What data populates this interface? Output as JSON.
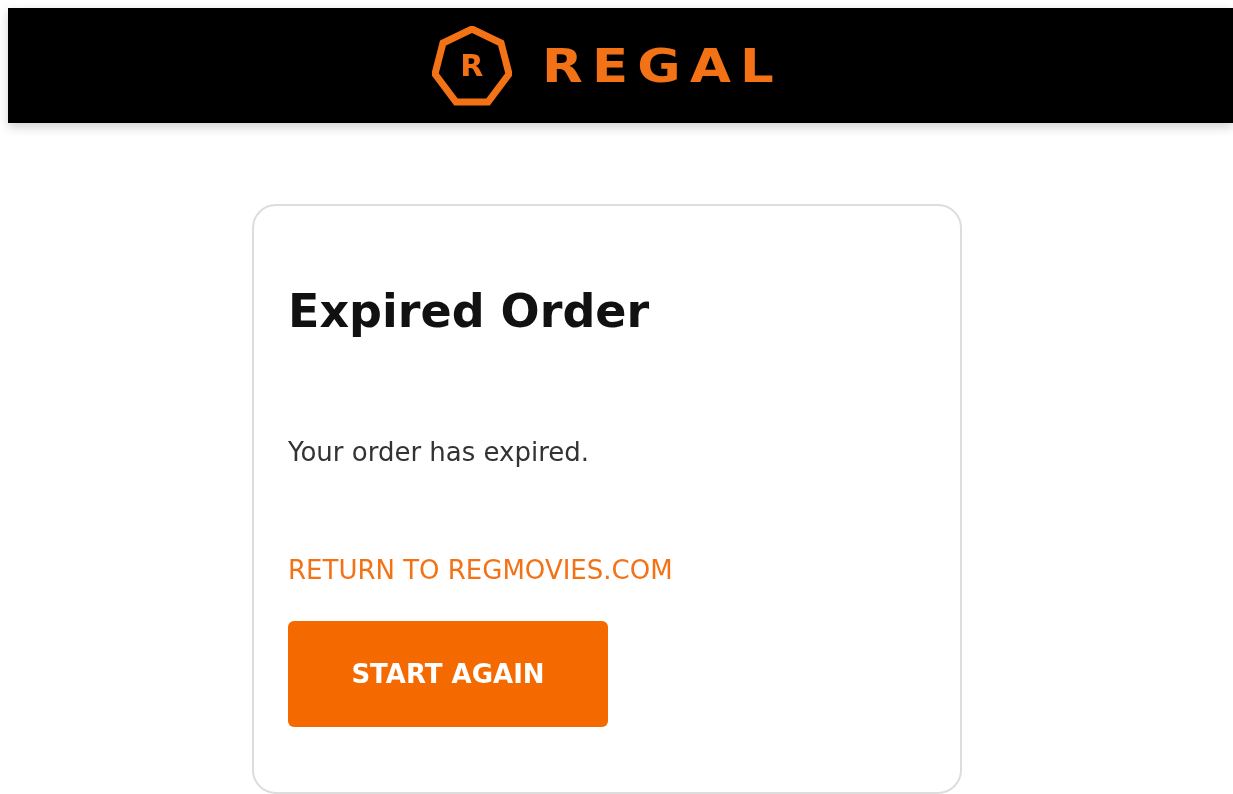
{
  "header": {
    "logo_letter": "R",
    "logo_text": "REGAL"
  },
  "card": {
    "title": "Expired Order",
    "message": "Your order has expired.",
    "link": "RETURN TO REGMOVIES.COM",
    "button": "START AGAIN"
  }
}
